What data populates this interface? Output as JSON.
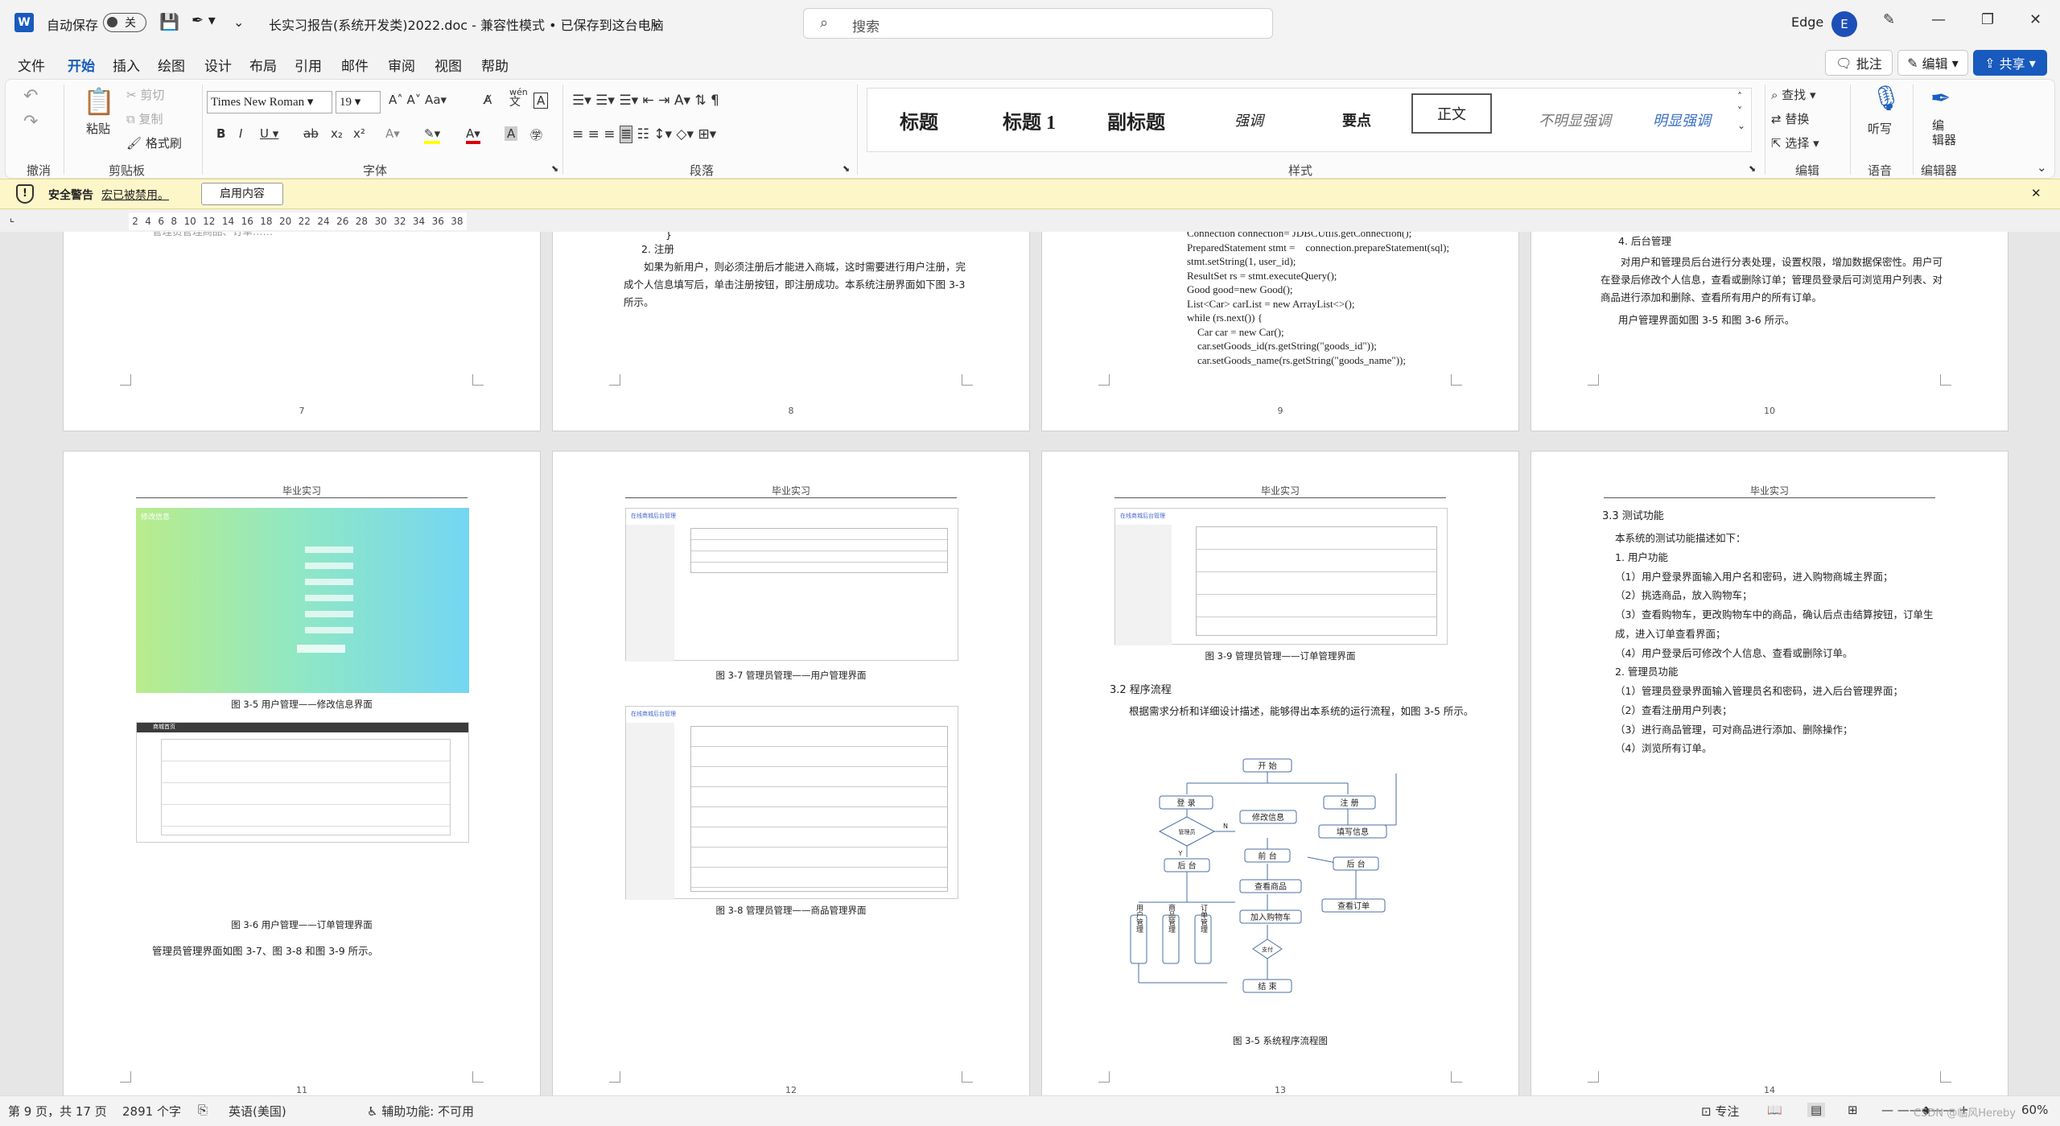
{
  "title": {
    "autosave_label": "自动保存",
    "autosave_state": "关",
    "doc_title": "长实习报告(系统开发类)2022.doc  -  兼容性模式  •  已保存到这台电脑",
    "search_placeholder": "搜索",
    "app_name": "Edge",
    "avatar_initial": "E"
  },
  "tabs": [
    "文件",
    "开始",
    "插入",
    "绘图",
    "设计",
    "布局",
    "引用",
    "邮件",
    "审阅",
    "视图",
    "帮助"
  ],
  "actions": {
    "comment": "批注",
    "edit": "编辑",
    "share": "共享"
  },
  "ribbon": {
    "undo_group": "撤消",
    "clipboard": {
      "paste": "粘贴",
      "cut": "剪切",
      "copy": "复制",
      "format_painter": "格式刷",
      "label": "剪贴板"
    },
    "font": {
      "name": "Times New Roman",
      "size": "19",
      "label": "字体",
      "wen_top": "wén",
      "wen_bottom": "文"
    },
    "paragraph_label": "段落",
    "styles": {
      "items": [
        "标题",
        "标题 1",
        "副标题",
        "强调",
        "要点",
        "正文",
        "不明显强调",
        "明显强调"
      ],
      "label": "样式"
    },
    "editing": {
      "find": "查找",
      "replace": "替换",
      "select": "选择",
      "label": "编辑"
    },
    "voice": {
      "dictate": "听写",
      "label": "语音"
    },
    "editor": {
      "button": "编\n辑器",
      "label": "编辑器"
    }
  },
  "security": {
    "title": "安全警告",
    "message": "宏已被禁用。",
    "button": "启用内容"
  },
  "ruler_ticks": [
    "2",
    "4",
    "6",
    "8",
    "10",
    "12",
    "14",
    "16",
    "18",
    "20",
    "22",
    "24",
    "26",
    "28",
    "30",
    "32",
    "34",
    "36",
    "38"
  ],
  "pages": {
    "p7": {
      "num": "7",
      "top_text": "管理员管理商品、订单……"
    },
    "p8": {
      "num": "8",
      "brace": "}",
      "sub_title": "2. 注册",
      "para": "如果为新用户，则必须注册后才能进入商城，这时需要进行用户注册，完成个人信息填写后，单击注册按钮，即注册成功。本系统注册界面如下图 3-3 所示。"
    },
    "p9": {
      "num": "9",
      "code": [
        "Connection connection= JDBCUtils.getConnection();",
        "PreparedStatement stmt =    connection.prepareStatement(sql);",
        "stmt.setString(1, user_id);",
        "ResultSet rs = stmt.executeQuery();",
        "Good good=new Good();",
        "List<Car> carList = new ArrayList<>();",
        "while (rs.next()) {",
        "    Car car = new Car();",
        "    car.setGoods_id(rs.getString(\"goods_id\"));",
        "    car.setGoods_name(rs.getString(\"goods_name\"));"
      ]
    },
    "p10": {
      "num": "10",
      "sub_title": "4. 后台管理",
      "para": "对用户和管理员后台进行分表处理，设置权限，增加数据保密性。用户可在登录后修改个人信息，查看或删除订单；管理员登录后可浏览用户列表、对商品进行添加和删除、查看所有用户的所有订单。",
      "line2": "用户管理界面如图 3-5 和图 3-6 所示。"
    },
    "p11": {
      "num": "11",
      "header": "毕业实习",
      "cap1": "图 3-5      用户管理——修改信息界面",
      "cap2": "图 3-6      用户管理——订单管理界面",
      "para": "管理员管理界面如图 3-7、图 3-8 和图 3-9 所示。",
      "shot1_title": "修改信息",
      "shot2_title": "商城首页"
    },
    "p12": {
      "num": "12",
      "header": "毕业实习",
      "cap1": "图 3-7      管理员管理——用户管理界面",
      "cap2": "图 3-8      管理员管理——商品管理界面",
      "admin_title": "在线商城后台管理"
    },
    "p13": {
      "num": "13",
      "header": "毕业实习",
      "cap1": "图 3-9      管理员管理——订单管理界面",
      "section": "3.2    程序流程",
      "para": "根据需求分析和详细设计描述，能够得出本系统的运行流程，如图 3-5 所示。",
      "cap2": "图 3-5      系统程序流程图",
      "flow": {
        "start": "开 始",
        "login": "登 录",
        "modify": "修改信息",
        "register": "注 册",
        "fill": "填写信息",
        "role": "管理员",
        "n": "N",
        "y": "Y",
        "front": "前 台",
        "back1": "后 台",
        "view_goods": "查看商品",
        "back2": "后 台",
        "add_cart": "加入购物车",
        "view_order": "查看订单",
        "pay": "支付",
        "user_mgmt": "用户管理",
        "goods_mgmt": "商品管理",
        "order_mgmt": "订单管理",
        "end": "结 束"
      }
    },
    "p14": {
      "num": "14",
      "header": "毕业实习",
      "section": "3.3    测试功能",
      "lines": [
        "本系统的测试功能描述如下：",
        "1.  用户功能",
        "（1）用户登录界面输入用户名和密码，进入购物商城主界面；",
        "（2）挑选商品，放入购物车；",
        "（3）查看购物车，更改购物车中的商品，确认后点击结算按钮，订单生成，进入订单查看界面；",
        "（4）用户登录后可修改个人信息、查看或删除订单。",
        "2.  管理员功能",
        "（1）管理员登录界面输入管理员名和密码，进入后台管理界面；",
        "（2）查看注册用户列表；",
        "（3）进行商品管理，可对商品进行添加、删除操作；",
        "（4）浏览所有订单。"
      ]
    }
  },
  "status": {
    "page": "第 9 页，共 17 页",
    "words": "2891 个字",
    "language": "英语(美国)",
    "accessibility": "辅助功能: 不可用",
    "focus": "专注",
    "zoom": "60%",
    "watermark": "CSDN @临风Hereby"
  },
  "colors": {
    "accent": "#185abd",
    "security_bg": "#fdf6c8"
  }
}
